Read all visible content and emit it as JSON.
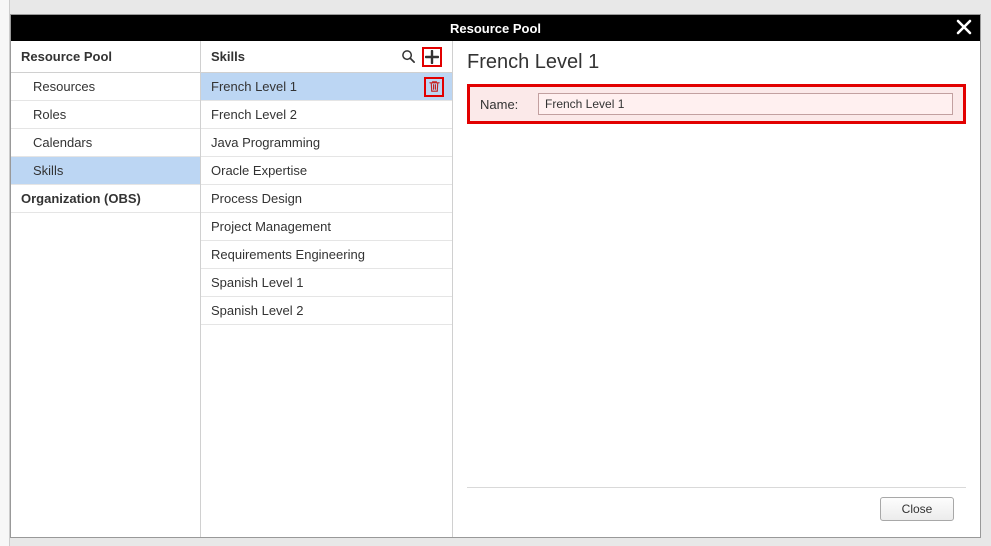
{
  "dialog": {
    "title": "Resource Pool"
  },
  "leftPanel": {
    "header": "Resource Pool",
    "items": [
      {
        "label": "Resources",
        "bold": false,
        "selected": false
      },
      {
        "label": "Roles",
        "bold": false,
        "selected": false
      },
      {
        "label": "Calendars",
        "bold": false,
        "selected": false
      },
      {
        "label": "Skills",
        "bold": false,
        "selected": true
      },
      {
        "label": "Organization (OBS)",
        "bold": true,
        "selected": false
      }
    ]
  },
  "midPanel": {
    "header": "Skills",
    "items": [
      {
        "label": "French Level 1",
        "selected": true
      },
      {
        "label": "French Level 2",
        "selected": false
      },
      {
        "label": "Java Programming",
        "selected": false
      },
      {
        "label": "Oracle Expertise",
        "selected": false
      },
      {
        "label": "Process Design",
        "selected": false
      },
      {
        "label": "Project Management",
        "selected": false
      },
      {
        "label": "Requirements Engineering",
        "selected": false
      },
      {
        "label": "Spanish Level 1",
        "selected": false
      },
      {
        "label": "Spanish Level 2",
        "selected": false
      }
    ]
  },
  "detail": {
    "title": "French Level 1",
    "name_label": "Name:",
    "name_value": "French Level 1"
  },
  "footer": {
    "close_label": "Close"
  }
}
